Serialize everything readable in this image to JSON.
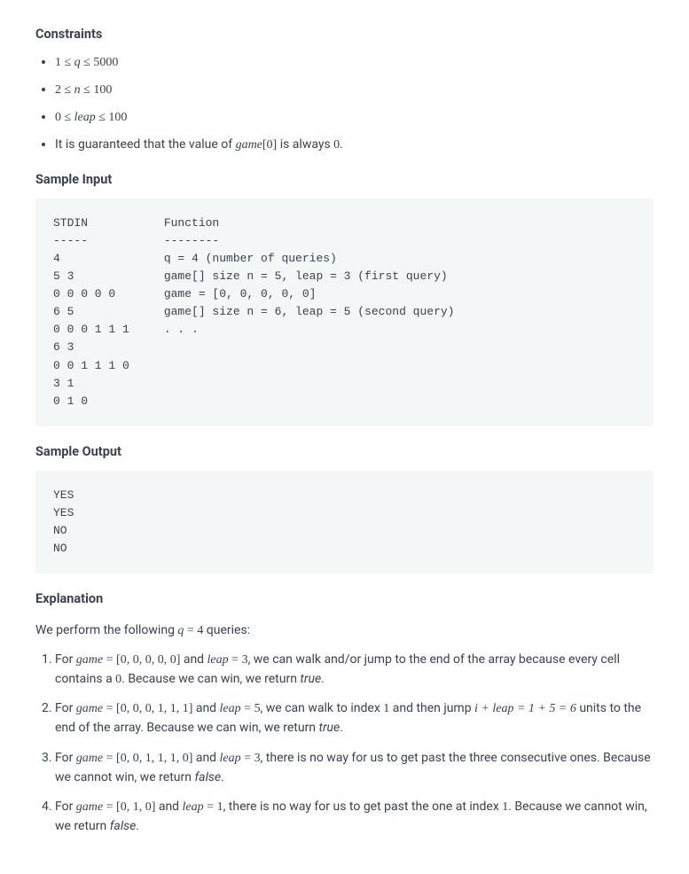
{
  "headings": {
    "constraints": "Constraints",
    "sample_input": "Sample Input",
    "sample_output": "Sample Output",
    "explanation": "Explanation"
  },
  "constraints": {
    "c1": {
      "lhs": "1",
      "op1": "≤",
      "var": "q",
      "op2": "≤",
      "rhs": "5000"
    },
    "c2": {
      "lhs": "2",
      "op1": "≤",
      "var": "n",
      "op2": "≤",
      "rhs": "100"
    },
    "c3": {
      "lhs": "0",
      "op1": "≤",
      "var": "leap",
      "op2": "≤",
      "rhs": "100"
    },
    "c4_pre": "It is guaranteed that the value of ",
    "c4_expr_var": "game",
    "c4_expr_idx": "[0]",
    "c4_post": " is always ",
    "c4_val": "0",
    "c4_end": "."
  },
  "sample_input_block": "STDIN           Function\n-----           --------\n4               q = 4 (number of queries)\n5 3             game[] size n = 5, leap = 3 (first query)\n0 0 0 0 0       game = [0, 0, 0, 0, 0]\n6 5             game[] size n = 6, leap = 5 (second query)\n0 0 0 1 1 1     . . .\n6 3\n0 0 1 1 1 0\n3 1\n0 1 0",
  "sample_output_block": "YES\nYES\nNO\nNO",
  "explanation_intro": {
    "pre": "We perform the following ",
    "expr_var": "q",
    "expr_eq": " = ",
    "expr_val": "4",
    "post": " queries:"
  },
  "explanation_items": [
    {
      "pre": "For ",
      "game_var": "game",
      "eq": " = ",
      "game_arr": "[0, 0, 0, 0, 0]",
      "and": " and ",
      "leap_var": "leap",
      "leap_val": "3",
      "tail": ", we can walk and/or jump to the end of the array because every cell contains a ",
      "zero": "0",
      "tail2": ". Because we can win, we return ",
      "ret": "true",
      "end": "."
    },
    {
      "pre": "For ",
      "game_var": "game",
      "eq": " = ",
      "game_arr": "[0, 0, 0, 1, 1, 1]",
      "and": " and ",
      "leap_var": "leap",
      "leap_val": "5",
      "tail": ", we can walk to index ",
      "idx1": "1",
      "tail2": " and then jump ",
      "jump_expr": "i + leap = 1 + 5 = 6",
      "tail3": " units to the end of the array. Because we can win, we return ",
      "ret": "true",
      "end": "."
    },
    {
      "pre": "For ",
      "game_var": "game",
      "eq": " = ",
      "game_arr": "[0, 0, 1, 1, 1, 0]",
      "and": " and ",
      "leap_var": "leap",
      "leap_val": "3",
      "tail": ", there is no way for us to get past the three consecutive ones. Because we cannot win, we return ",
      "ret": "false",
      "end": "."
    },
    {
      "pre": "For ",
      "game_var": "game",
      "eq": " = ",
      "game_arr": "[0, 1, 0]",
      "and": " and ",
      "leap_var": "leap",
      "leap_val": "1",
      "tail": ", there is no way for us to get past the one at index ",
      "idx1": "1",
      "tail2": ". Because we cannot win, we return ",
      "ret": "false",
      "end": "."
    }
  ]
}
